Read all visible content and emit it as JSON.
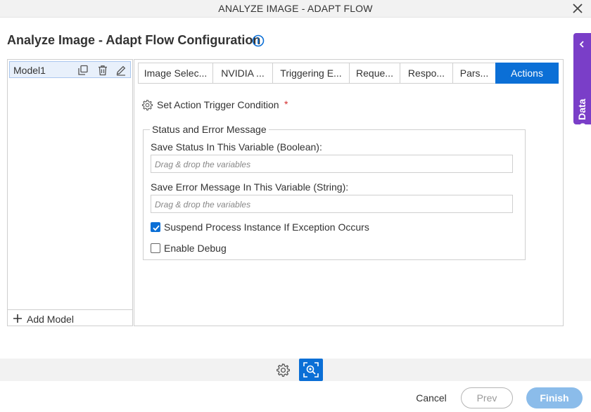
{
  "window": {
    "title": "ANALYZE IMAGE - ADAPT FLOW",
    "close_icon": "close-icon"
  },
  "header": {
    "page_title": "Analyze Image - Adapt Flow Configuration",
    "info_icon": "info-circle-icon"
  },
  "app_data": {
    "label": "App Data",
    "icon": "chevron-left-icon",
    "color": "#7a3ec8"
  },
  "models": {
    "items": [
      {
        "name": "Model1",
        "selected": true
      }
    ],
    "icons": [
      "copy-icon",
      "trash-icon",
      "edit-icon"
    ],
    "add_label": "Add Model"
  },
  "tabs": [
    {
      "label": "Image Selec...",
      "active": false
    },
    {
      "label": "NVIDIA ...",
      "active": false
    },
    {
      "label": "Triggering E...",
      "active": false
    },
    {
      "label": "Reque...",
      "active": false
    },
    {
      "label": "Respo...",
      "active": false
    },
    {
      "label": "Pars...",
      "active": false
    },
    {
      "label": "Actions",
      "active": true
    }
  ],
  "actions": {
    "trigger_label": "Set Action Trigger Condition",
    "required_mark": "*",
    "group_title": "Status and Error Message",
    "status_label": "Save Status In This Variable (Boolean):",
    "status_placeholder": "Drag & drop the variables",
    "error_label": "Save Error Message In This Variable (String):",
    "error_placeholder": "Drag & drop the variables",
    "suspend_label": "Suspend Process Instance If Exception Occurs",
    "suspend_checked": true,
    "debug_label": "Enable Debug",
    "debug_checked": false
  },
  "footer": {
    "gear_icon": "gear-icon",
    "scan_icon": "image-scan-icon",
    "cancel": "Cancel",
    "prev": "Prev",
    "finish": "Finish"
  },
  "colors": {
    "accent": "#0b6fd6",
    "finish_button": "#8bbcea",
    "required": "#d32f2f"
  }
}
